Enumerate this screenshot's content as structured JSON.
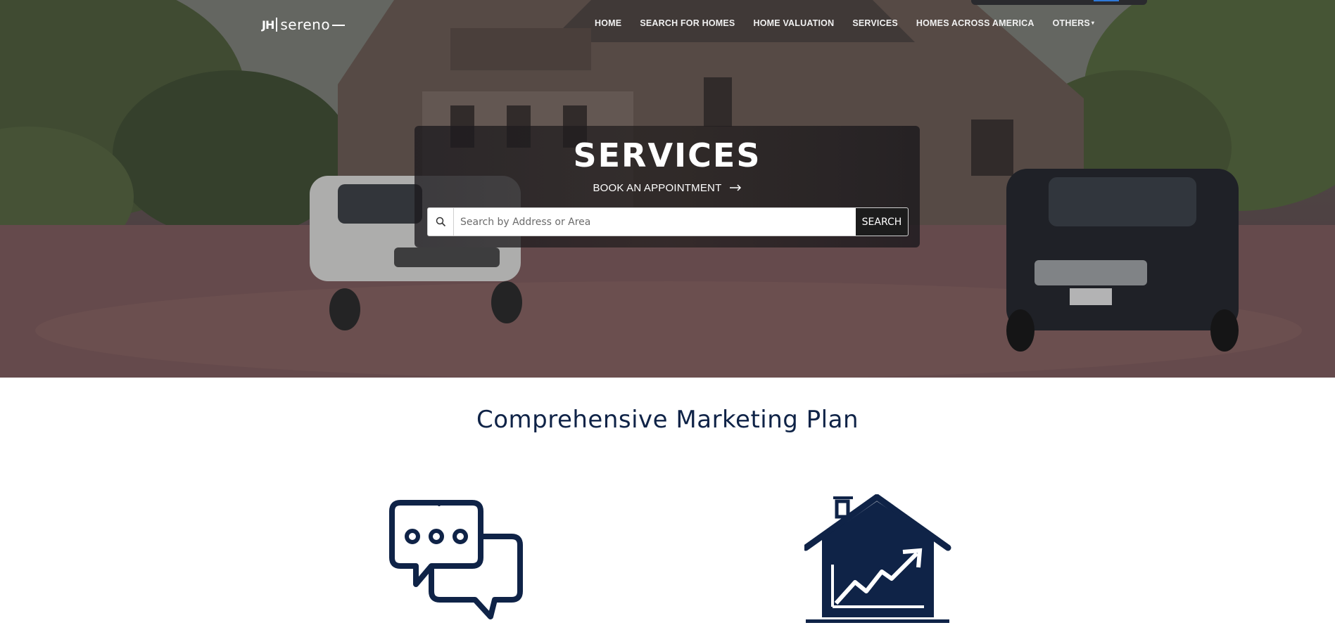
{
  "header": {
    "logo_mark": "JH",
    "logo_word": "sereno",
    "nav": [
      {
        "label": "HOME"
      },
      {
        "label": "SEARCH FOR HOMES"
      },
      {
        "label": "HOME VALUATION"
      },
      {
        "label": "SERVICES"
      },
      {
        "label": "HOMES ACROSS AMERICA"
      },
      {
        "label": "OTHERS"
      }
    ]
  },
  "hero": {
    "title": "SERVICES",
    "cta_label": "BOOK AN APPOINTMENT",
    "search": {
      "placeholder": "Search by Address or Area",
      "value": "",
      "button_label": "SEARCH"
    }
  },
  "section": {
    "title": "Comprehensive Marketing Plan",
    "icons": [
      "chat-bubbles-icon",
      "house-growth-icon"
    ]
  },
  "colors": {
    "navy": "#0f2347",
    "button_dark": "#1c1c1c"
  }
}
